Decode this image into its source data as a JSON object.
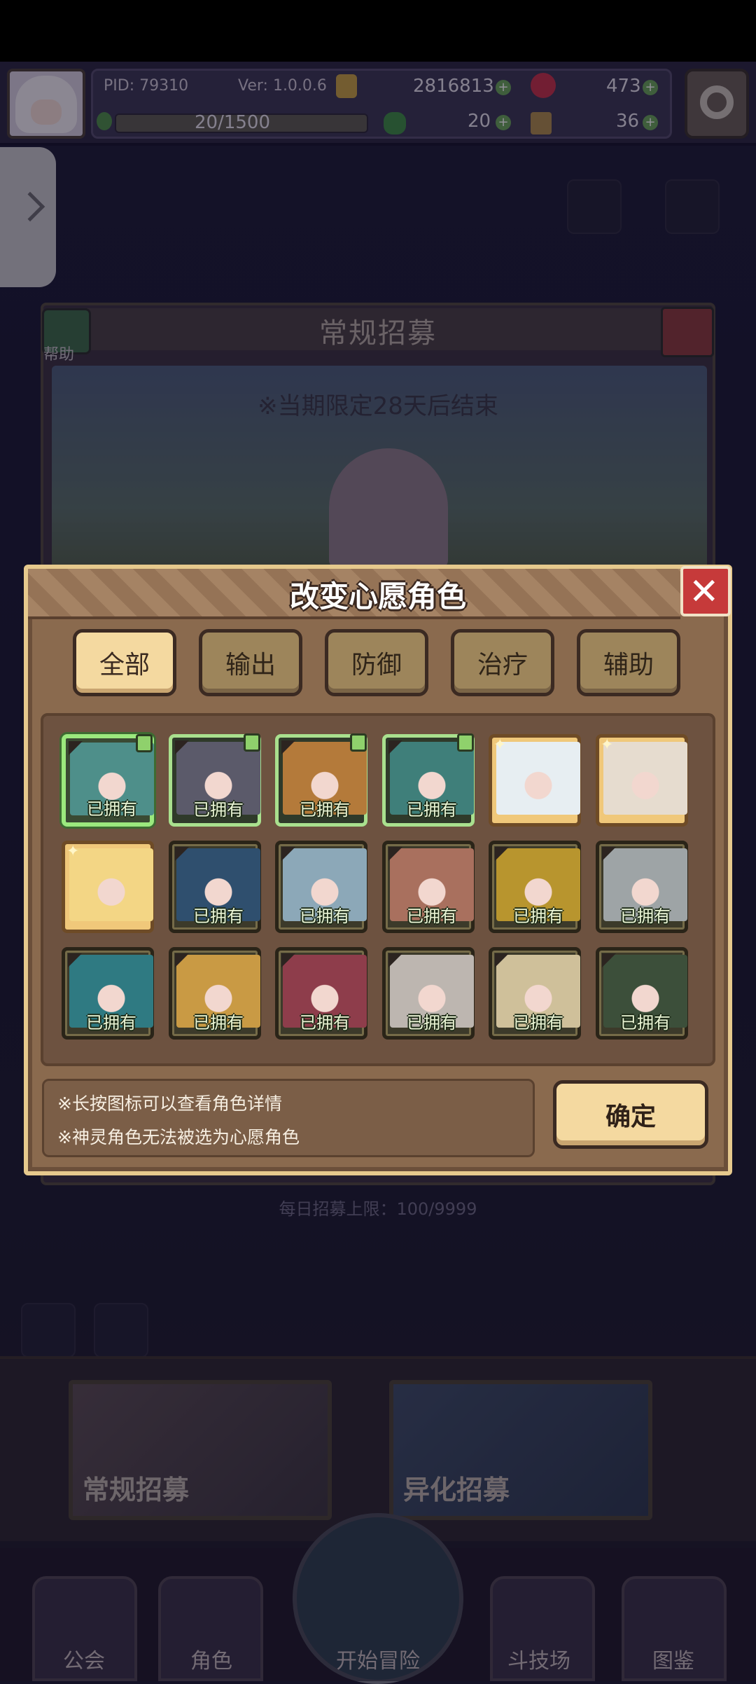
{
  "hud": {
    "pid": "PID: 79310",
    "version": "Ver: 1.0.0.6",
    "gold": "2816813",
    "gems": "473",
    "exp": "20/1500",
    "clover": "20",
    "tickets": "36"
  },
  "background": {
    "panel_title": "常规招募",
    "help_label": "帮助",
    "limit_notice": "※当期限定28天后结束",
    "daily_limit": "每日招募上限：100/9999",
    "recruit_normal": "常规招募",
    "recruit_mutation": "异化招募"
  },
  "nav": {
    "guild": "公会",
    "character": "角色",
    "adventure": "开始冒险",
    "arena": "斗技场",
    "codex": "图鉴"
  },
  "modal": {
    "title": "改变心愿角色",
    "tabs": [
      {
        "label": "全部",
        "active": true
      },
      {
        "label": "输出",
        "active": false
      },
      {
        "label": "防御",
        "active": false
      },
      {
        "label": "治疗",
        "active": false
      },
      {
        "label": "辅助",
        "active": false
      }
    ],
    "characters": [
      {
        "label": "已拥有",
        "frame": "selected",
        "color": "#4e8f8a"
      },
      {
        "label": "已拥有",
        "frame": "green",
        "color": "#5b5a6a"
      },
      {
        "label": "已拥有",
        "frame": "green",
        "color": "#b47a3a"
      },
      {
        "label": "已拥有",
        "frame": "green",
        "color": "#3f7f7a"
      },
      {
        "label": "",
        "frame": "gold",
        "color": "#e7eef2"
      },
      {
        "label": "",
        "frame": "gold",
        "color": "#e6dccf"
      },
      {
        "label": "",
        "frame": "gold",
        "color": "#f3d685"
      },
      {
        "label": "已拥有",
        "frame": "dark",
        "color": "#2f4f6e"
      },
      {
        "label": "已拥有",
        "frame": "dark",
        "color": "#8ca8b8"
      },
      {
        "label": "已拥有",
        "frame": "dark",
        "color": "#a9705e"
      },
      {
        "label": "已拥有",
        "frame": "dark",
        "color": "#b8952e"
      },
      {
        "label": "已拥有",
        "frame": "dark",
        "color": "#9ea4a6"
      },
      {
        "label": "已拥有",
        "frame": "dark",
        "color": "#2f7a82"
      },
      {
        "label": "已拥有",
        "frame": "dark",
        "color": "#c99a44"
      },
      {
        "label": "已拥有",
        "frame": "dark",
        "color": "#8e3d4b"
      },
      {
        "label": "已拥有",
        "frame": "dark",
        "color": "#bdb6b0"
      },
      {
        "label": "已拥有",
        "frame": "dark",
        "color": "#cfc09a"
      },
      {
        "label": "已拥有",
        "frame": "dark",
        "color": "#3c4f3a"
      }
    ],
    "note1": "※长按图标可以查看角色详情",
    "note2": "※神灵角色无法被选为心愿角色",
    "confirm": "确定"
  },
  "colors": {
    "accent_gold": "#f4d9a0",
    "close_red": "#c63a3a",
    "owned_green": "#a9e08e"
  }
}
